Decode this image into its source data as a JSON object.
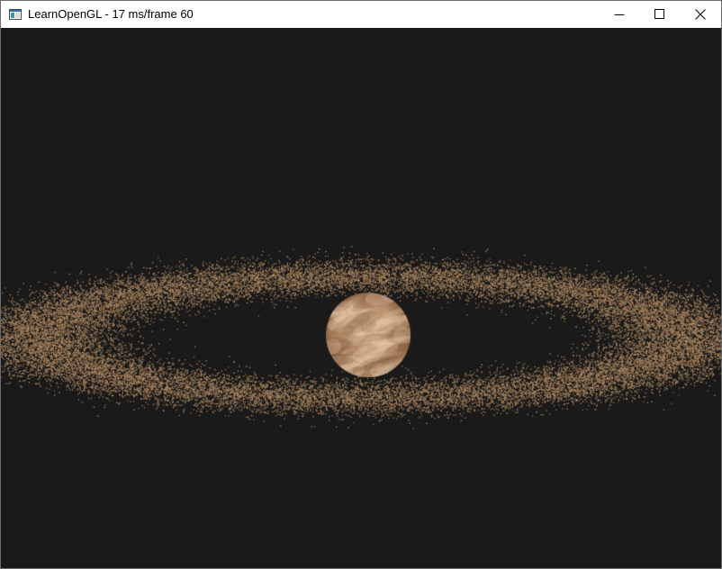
{
  "window": {
    "title": "LearnOpenGL - 17 ms/frame 60",
    "icon": "app-window-icon"
  },
  "controls": {
    "minimize_icon": "minimize-icon",
    "maximize_icon": "maximize-icon",
    "close_icon": "close-icon"
  },
  "scene": {
    "background_color": "#1a1a1a",
    "planet_colors": [
      "#c9a27d",
      "#a37a56",
      "#e2c4a3",
      "#8c6444"
    ],
    "asteroid_color": "#b08a63"
  }
}
